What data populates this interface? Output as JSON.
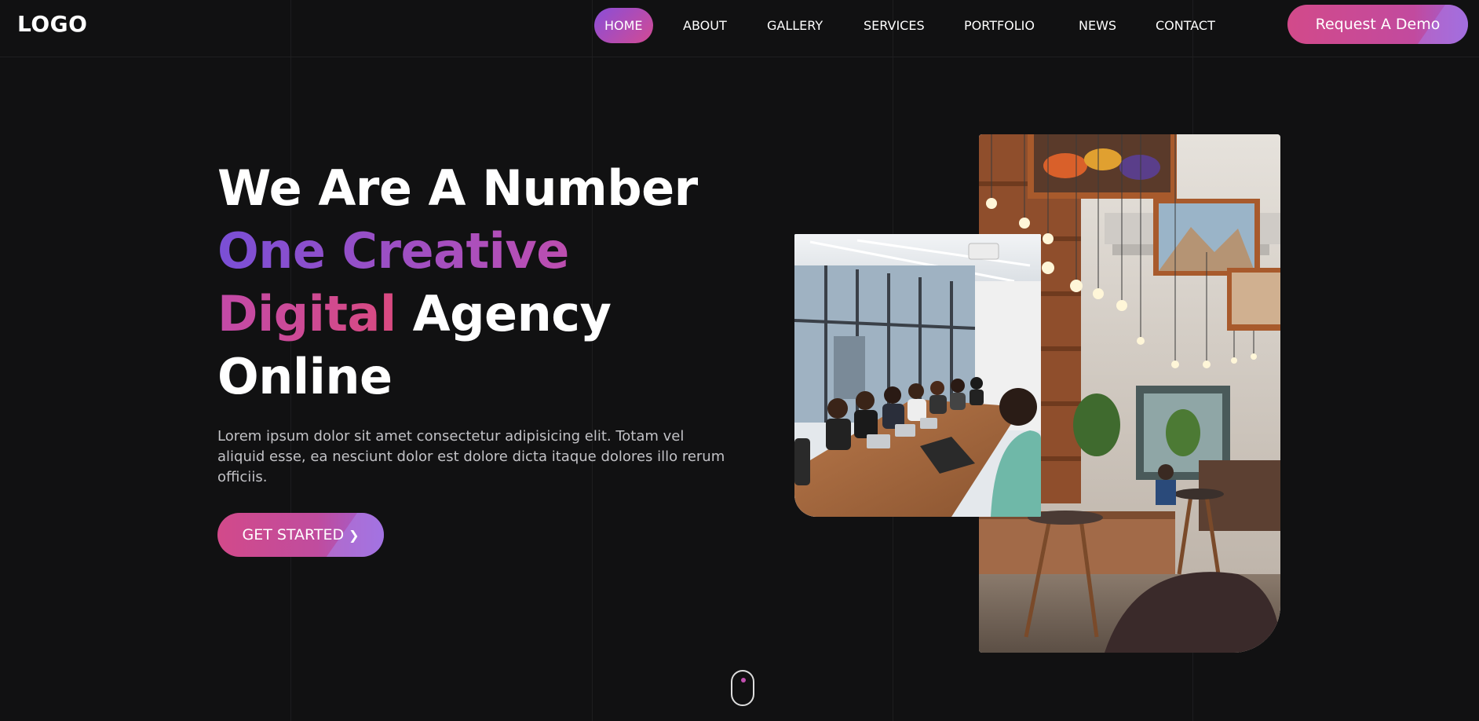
{
  "header": {
    "logo": "LOGO",
    "nav": [
      {
        "label": "HOME",
        "active": true
      },
      {
        "label": "ABOUT",
        "active": false
      },
      {
        "label": "GALLERY",
        "active": false
      },
      {
        "label": "SERVICES",
        "active": false
      },
      {
        "label": "PORTFOLIO",
        "active": false
      },
      {
        "label": "NEWS",
        "active": false
      },
      {
        "label": "CONTACT",
        "active": false
      }
    ],
    "demo_button": "Request A Demo"
  },
  "hero": {
    "title_line1": "We Are A Number",
    "title_line2": "One Creative",
    "title_line3_accent": "Digital",
    "title_line3_rest": " Agency",
    "title_line4": "Online",
    "description": "Lorem ipsum dolor sit amet consectetur adipisicing elit. Totam vel aliquid esse, ea nesciunt dolor est dolore dicta itaque dolores illo rerum officiis.",
    "cta_label": "GET STARTED",
    "cta_icon": "chevron-right-icon"
  },
  "images": {
    "back": "cafe-interior-photo",
    "front": "meeting-room-photo"
  },
  "colors": {
    "background": "#111112",
    "gradient_start": "#8a4ed8",
    "gradient_end": "#d24a8a"
  }
}
